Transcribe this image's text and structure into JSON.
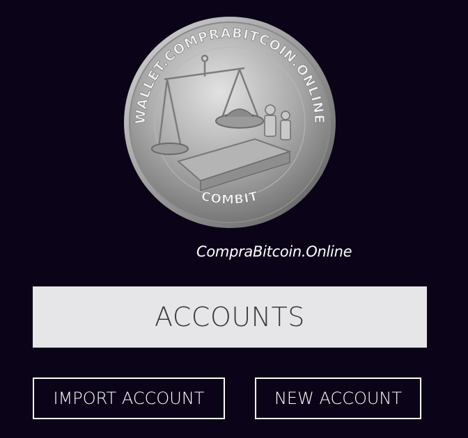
{
  "logo": {
    "ring_text": "WALLET.COMPRABITCOIN.ONLINE",
    "bottom_text": "COMBIT",
    "icon": "coin-logo-icon"
  },
  "tagline": "CompraBitcoin.Online",
  "accounts": {
    "title": "ACCOUNTS"
  },
  "actions": {
    "import_label": "IMPORT ACCOUNT",
    "new_label": "NEW ACCOUNT"
  },
  "colors": {
    "background": "#0b0418",
    "banner": "#e6e6e8",
    "button_border": "#ffffff"
  }
}
